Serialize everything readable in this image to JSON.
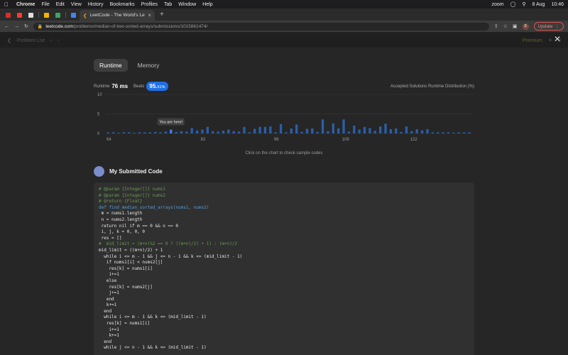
{
  "menubar": {
    "app": "Chrome",
    "items": [
      "File",
      "Edit",
      "View",
      "History",
      "Bookmarks",
      "Profiles",
      "Tab",
      "Window",
      "Help"
    ],
    "right_app": "zoom",
    "date": "8 Aug",
    "time": "10:46"
  },
  "browser": {
    "tab_title": "LeetCode - The World's Leadi",
    "url_host": "leetcode.com",
    "url_path": "/problems/median-of-two-sorted-arrays/submissions/1015861474/",
    "profile_initial": "S",
    "update_label": "Update"
  },
  "lcnav": {
    "problem_list": "Problem List",
    "premium": "Premium",
    "fire_count": "0"
  },
  "overlay": {
    "tabs": [
      {
        "label": "Runtime",
        "active": true
      },
      {
        "label": "Memory",
        "active": false
      }
    ],
    "runtime_label": "Runtime",
    "runtime_value": "76 ms",
    "beats_label": "Beats",
    "beats_value": "95.",
    "beats_decimals": "51%",
    "distribution_label": "Accepted Solutions Runtime Distribution (%)",
    "tooltip": "You are here!",
    "hint": "Click on the chart to check sample codes",
    "submitted_title": "My Submitted Code"
  },
  "chart_data": {
    "type": "bar",
    "title": "Accepted Solutions Runtime Distribution (%)",
    "xlabel": "",
    "ylabel": "",
    "ylim": [
      0,
      10
    ],
    "yticks": [
      0,
      5,
      10
    ],
    "xticks": [
      64,
      82,
      96,
      109,
      122
    ],
    "x": [
      64,
      65,
      66,
      67,
      68,
      69,
      70,
      71,
      72,
      73,
      74,
      75,
      76,
      77,
      78,
      79,
      80,
      81,
      82,
      83,
      84,
      85,
      86,
      87,
      88,
      89,
      90,
      91,
      92,
      93,
      94,
      95,
      96,
      97,
      98,
      99,
      100,
      101,
      102,
      103,
      104,
      105,
      106,
      107,
      108,
      109,
      110,
      111,
      112,
      113,
      114,
      115,
      116,
      117,
      118,
      119,
      120,
      121,
      122,
      123,
      124,
      125,
      126,
      127,
      128,
      129,
      130,
      131,
      132,
      133
    ],
    "values": [
      0.3,
      0.3,
      0.2,
      0.3,
      0.3,
      0.2,
      0.3,
      0.3,
      0.3,
      0.4,
      0.3,
      0.5,
      1.0,
      0.4,
      0.6,
      0.5,
      1.4,
      0.8,
      1.0,
      1.7,
      0.6,
      0.5,
      0.7,
      1.0,
      0.6,
      0.5,
      1.7,
      0.3,
      1.2,
      1.7,
      1.7,
      1.8,
      0.3,
      2.4,
      0.3,
      1.3,
      2.3,
      0.4,
      1.2,
      1.3,
      0.4,
      3.6,
      0.6,
      2.6,
      1.3,
      3.6,
      0.5,
      2.0,
      1.0,
      1.7,
      1.4,
      0.7,
      1.8,
      2.5,
      1.1,
      1.3,
      0.4,
      1.8,
      0.6,
      1.1,
      0.8,
      1.1,
      0.3,
      0.3,
      0.3,
      0.3,
      0.2,
      0.3,
      0.3,
      0.3
    ],
    "highlight_x": 76
  },
  "code": [
    {
      "cls": "c",
      "text": "# @param {Integer[]} nums1"
    },
    {
      "cls": "c",
      "text": "# @param {Integer[]} nums2"
    },
    {
      "cls": "c",
      "text": "# @return {Float}"
    },
    {
      "cls": "k",
      "text": "def find_median_sorted_arrays(nums1, nums2)"
    },
    {
      "cls": "n",
      "text": " m = nums1.length"
    },
    {
      "cls": "n",
      "text": " n = nums2.length"
    },
    {
      "cls": "n",
      "text": " return nil if m == 0 && n == 0"
    },
    {
      "cls": "n",
      "text": " i, j, k = 0, 0, 0"
    },
    {
      "cls": "n",
      "text": " res = []"
    },
    {
      "cls": "c",
      "text": "#  mid_limit = (m+n)%2 == 0 ? ((m+n)/2) + 1) : (m+n)/2"
    },
    {
      "cls": "n",
      "text": "mid_limit = ((m+n)/2) + 1"
    },
    {
      "cls": "n",
      "text": "  while i <= m - 1 && j <= n - 1 && k <= (mid_limit - 1)"
    },
    {
      "cls": "n",
      "text": "   if nums1[i] < nums2[j]"
    },
    {
      "cls": "n",
      "text": "    res[k] = nums1[i]"
    },
    {
      "cls": "n",
      "text": "    i+=1"
    },
    {
      "cls": "n",
      "text": "   else"
    },
    {
      "cls": "n",
      "text": "    res[k] = nums2[j]"
    },
    {
      "cls": "n",
      "text": "    j+=1"
    },
    {
      "cls": "n",
      "text": "   end"
    },
    {
      "cls": "n",
      "text": "   k+=1"
    },
    {
      "cls": "n",
      "text": "  end"
    },
    {
      "cls": "n",
      "text": "  while i <= m - 1 && k <= (mid_limit - 1)"
    },
    {
      "cls": "n",
      "text": "   res[k] = nums1[i]"
    },
    {
      "cls": "n",
      "text": "    i+=1"
    },
    {
      "cls": "n",
      "text": "    k+=1"
    },
    {
      "cls": "n",
      "text": "  end"
    },
    {
      "cls": "n",
      "text": "  while j <= n - 1 && k <= (mid_limit - 1)"
    }
  ],
  "colors": {
    "bar": "#2a5fa8",
    "bar_highlight": "#3b82f6",
    "badge": "#1f6fe5",
    "comment": "#6a9955",
    "keyword": "#569cd6"
  }
}
